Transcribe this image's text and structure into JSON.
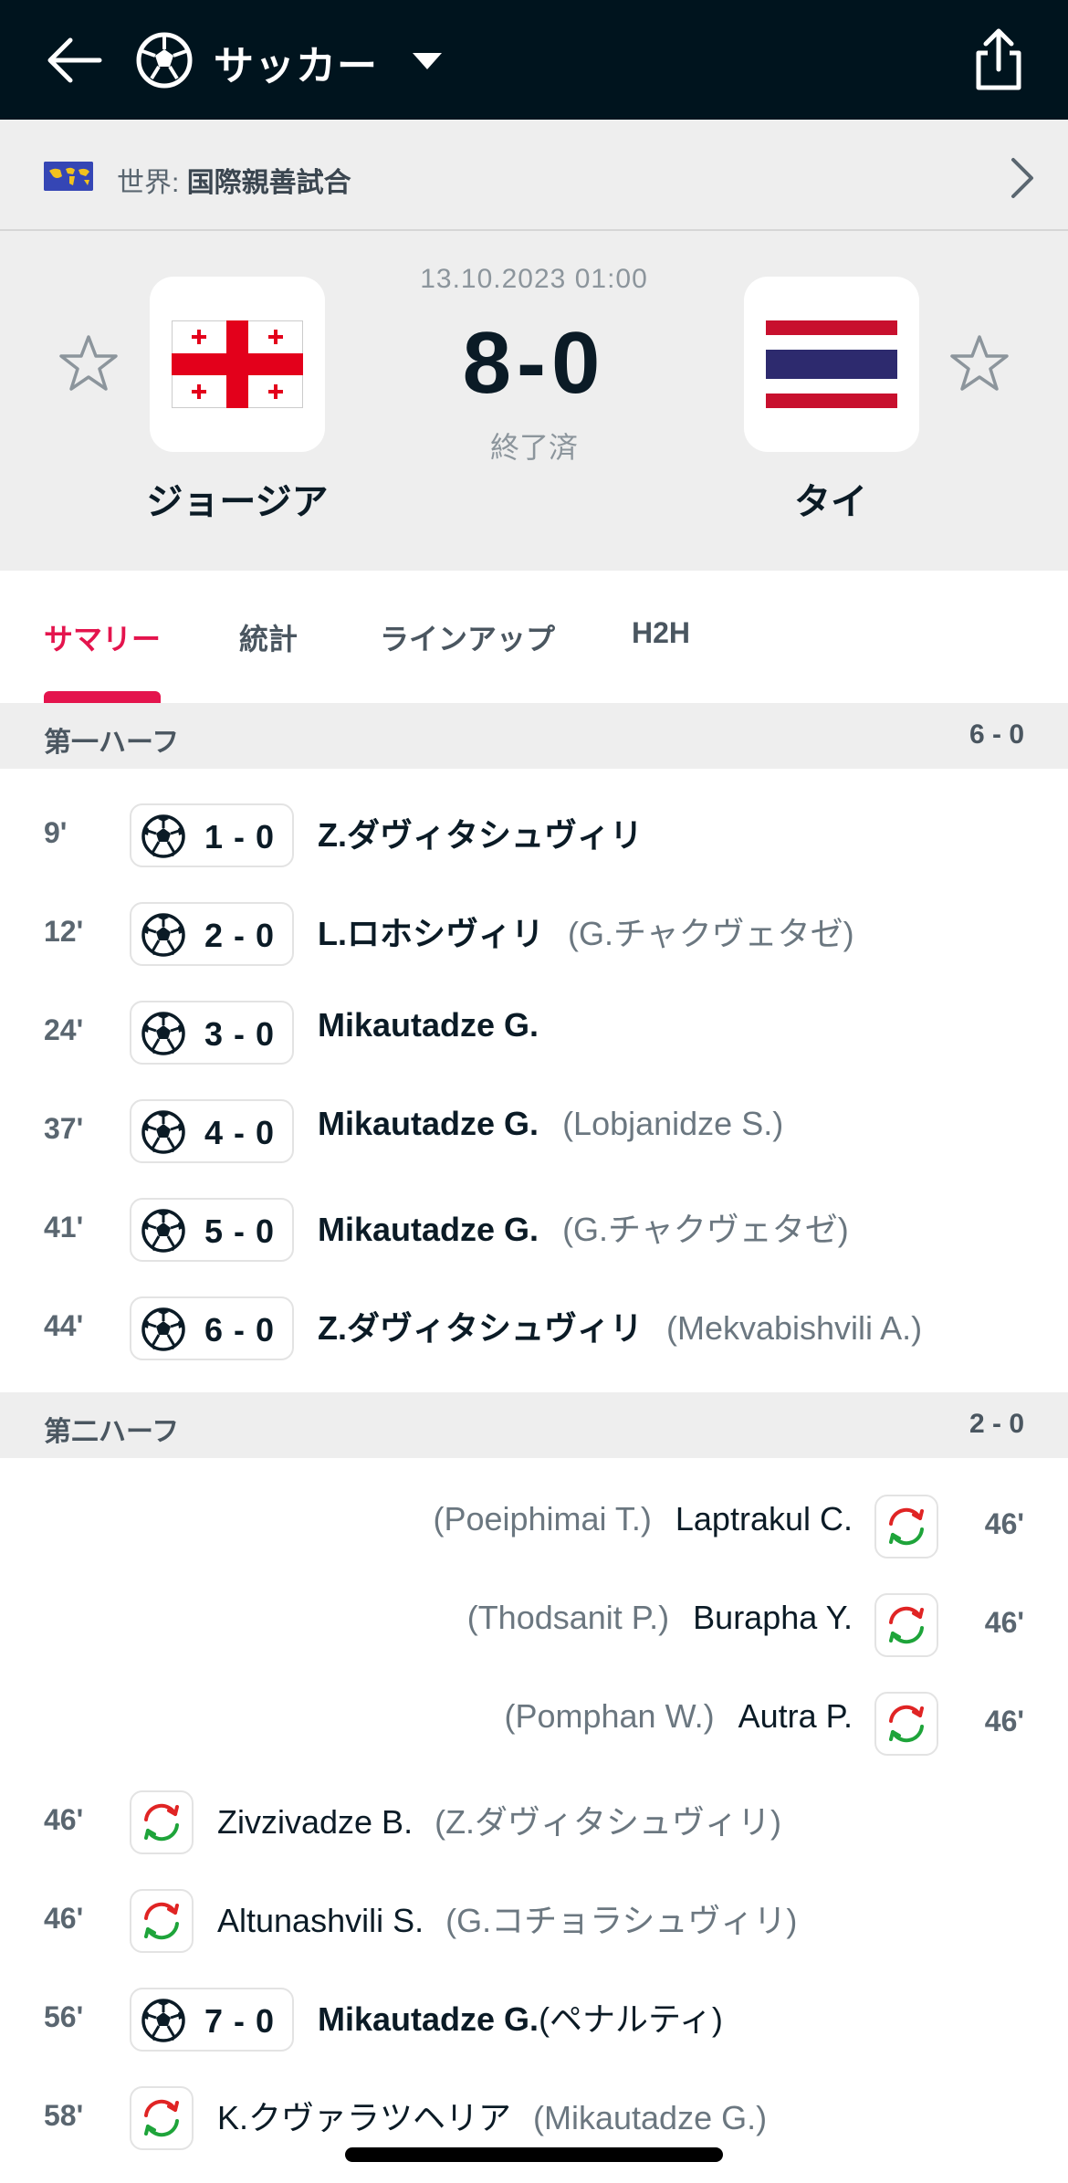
{
  "topbar": {
    "sport_title": "サッカー"
  },
  "league": {
    "country": "世界:",
    "name": "国際親善試合"
  },
  "match": {
    "datetime": "13.10.2023 01:00",
    "score": "8-0",
    "status": "終了済",
    "home": {
      "name": "ジョージア"
    },
    "away": {
      "name": "タイ"
    }
  },
  "tabs": [
    {
      "label": "サマリー",
      "active": true
    },
    {
      "label": "統計"
    },
    {
      "label": "ラインアップ"
    },
    {
      "label": "H2H"
    }
  ],
  "first_half": {
    "label": "第一ハーフ",
    "score": "6 - 0",
    "events": [
      {
        "minute": "9'",
        "score": "1 - 0",
        "player": "Z.ダヴィタシュヴィリ",
        "assist": ""
      },
      {
        "minute": "12'",
        "score": "2 - 0",
        "player": "L.ロホシヴィリ",
        "assist": "(G.チャクヴェタゼ)"
      },
      {
        "minute": "24'",
        "score": "3 - 0",
        "player": "Mikautadze G.",
        "assist": ""
      },
      {
        "minute": "37'",
        "score": "4 - 0",
        "player": "Mikautadze G.",
        "assist": "(Lobjanidze S.)"
      },
      {
        "minute": "41'",
        "score": "5 - 0",
        "player": "Mikautadze G.",
        "assist": "(G.チャクヴェタゼ)"
      },
      {
        "minute": "44'",
        "score": "6 - 0",
        "player": "Z.ダヴィタシュヴィリ",
        "assist": "(Mekvabishvili A.)"
      }
    ]
  },
  "second_half": {
    "label": "第二ハーフ",
    "score": "2 - 0",
    "away_subs": [
      {
        "minute": "46'",
        "player_in": "Laptrakul C.",
        "player_out": "(Poeiphimai T.)"
      },
      {
        "minute": "46'",
        "player_in": "Burapha Y.",
        "player_out": "(Thodsanit P.)"
      },
      {
        "minute": "46'",
        "player_in": "Autra P.",
        "player_out": "(Pomphan W.)"
      }
    ],
    "home_subs": [
      {
        "minute": "46'",
        "player_in": "Zivzivadze B.",
        "player_out": "(Z.ダヴィタシュヴィリ)"
      },
      {
        "minute": "46'",
        "player_in": "Altunashvili S.",
        "player_out": "(G.コチョラシュヴィリ)"
      }
    ],
    "goal": {
      "minute": "56'",
      "score": "7 - 0",
      "player": "Mikautadze G.",
      "note": "(ペナルティ)"
    },
    "last_sub": {
      "minute": "58'",
      "player_in": "K.クヴァラツヘリア",
      "player_out": "(Mikautadze G.)"
    }
  },
  "colors": {
    "topbar_bg": "#00141e",
    "accent": "#e4144d",
    "panel_bg": "#eeeeee",
    "sub_in_green": "#1ea43a",
    "sub_out_red": "#e02424"
  },
  "icons": [
    "back-arrow-icon",
    "soccer-ball-icon",
    "caret-down-icon",
    "share-icon",
    "world-flag-icon",
    "chevron-right-icon",
    "star-icon",
    "substitution-icon"
  ]
}
